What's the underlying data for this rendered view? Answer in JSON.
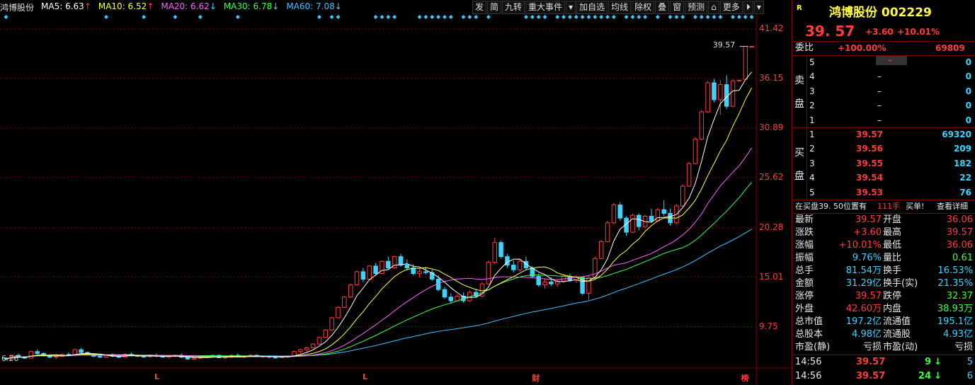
{
  "ma": {
    "stock": "鸿博股份",
    "ma5": {
      "label": "MA5: 6.63",
      "arrow": "↑",
      "color": "#ffffff"
    },
    "ma10": {
      "label": "MA10: 6.52",
      "arrow": "↑",
      "color": "#ffff40"
    },
    "ma20": {
      "label": "MA20: 6.62",
      "arrow": "↓",
      "color": "#ff60ff"
    },
    "ma30": {
      "label": "MA30: 6.78",
      "arrow": "↓",
      "color": "#40ff40"
    },
    "ma60": {
      "label": "MA60: 7.08",
      "arrow": "↓",
      "color": "#40c0ff"
    }
  },
  "toolbar": {
    "fa": "发",
    "jian": "简",
    "jiuzhuan": "九转",
    "events": "重大事件",
    "dropdown": "▾",
    "add": "加自选",
    "avg": "均线",
    "exright": "除权",
    "overlay": "叠",
    "window": "窗",
    "predict": "预测",
    "lock": "⌂",
    "more": "更多",
    "expand": "⏵",
    "dropdown2": "▾"
  },
  "axis": {
    "labels": [
      "41.42",
      "36.15",
      "30.89",
      "25.62",
      "20.28",
      "15.01",
      "9.75"
    ],
    "low_label": "6.26",
    "high_label": "39.57",
    "markers": [
      {
        "text": "L",
        "pos": 0.195
      },
      {
        "text": "L",
        "pos": 0.458
      },
      {
        "text": "财",
        "pos": 0.672
      },
      {
        "text": "榜",
        "pos": 0.936
      }
    ]
  },
  "chart_data": {
    "type": "candlestick",
    "ylim": [
      5.5,
      43.0
    ],
    "y_ticks": [
      41.42,
      36.15,
      30.89,
      25.62,
      20.28,
      15.01,
      9.75
    ],
    "n": 120,
    "candles": [
      [
        6.4,
        6.5,
        6.2,
        6.3
      ],
      [
        6.3,
        6.8,
        6.25,
        6.7
      ],
      [
        6.7,
        6.9,
        6.5,
        6.55
      ],
      [
        6.55,
        6.6,
        6.3,
        6.4
      ],
      [
        6.4,
        7.2,
        6.35,
        7.1
      ],
      [
        7.1,
        7.3,
        6.8,
        6.9
      ],
      [
        6.9,
        7.0,
        6.6,
        6.7
      ],
      [
        6.7,
        6.8,
        6.4,
        6.5
      ],
      [
        6.5,
        6.7,
        6.3,
        6.6
      ],
      [
        6.6,
        6.9,
        6.5,
        6.8
      ],
      [
        6.8,
        7.0,
        6.6,
        6.7
      ],
      [
        6.7,
        7.4,
        6.6,
        7.3
      ],
      [
        7.3,
        7.5,
        6.9,
        7.0
      ],
      [
        7.0,
        7.1,
        6.7,
        6.8
      ],
      [
        6.8,
        6.9,
        6.5,
        6.6
      ],
      [
        6.6,
        6.7,
        6.4,
        6.5
      ],
      [
        6.5,
        6.8,
        6.4,
        6.7
      ],
      [
        6.7,
        6.9,
        6.5,
        6.6
      ],
      [
        6.6,
        6.7,
        6.4,
        6.5
      ],
      [
        6.5,
        6.9,
        6.45,
        6.8
      ],
      [
        6.8,
        7.0,
        6.6,
        6.7
      ],
      [
        6.7,
        6.8,
        6.5,
        6.6
      ],
      [
        6.6,
        6.7,
        6.4,
        6.55
      ],
      [
        6.55,
        6.8,
        6.5,
        6.7
      ],
      [
        6.7,
        6.9,
        6.5,
        6.6
      ],
      [
        6.6,
        6.75,
        6.45,
        6.5
      ],
      [
        6.5,
        6.7,
        6.4,
        6.6
      ],
      [
        6.6,
        6.8,
        6.5,
        6.7
      ],
      [
        6.7,
        6.9,
        6.4,
        6.5
      ],
      [
        6.5,
        6.6,
        6.2,
        6.3
      ],
      [
        6.3,
        6.5,
        6.2,
        6.4
      ],
      [
        6.4,
        6.6,
        6.3,
        6.5
      ],
      [
        6.5,
        6.7,
        6.4,
        6.6
      ],
      [
        6.6,
        6.8,
        6.5,
        6.7
      ],
      [
        6.7,
        6.8,
        6.4,
        6.45
      ],
      [
        6.45,
        6.6,
        6.3,
        6.5
      ],
      [
        6.5,
        6.8,
        6.45,
        6.7
      ],
      [
        6.7,
        6.9,
        6.5,
        6.55
      ],
      [
        6.55,
        6.7,
        6.4,
        6.6
      ],
      [
        6.6,
        6.8,
        6.5,
        6.7
      ],
      [
        6.7,
        6.8,
        6.5,
        6.55
      ],
      [
        6.55,
        6.7,
        6.4,
        6.6
      ],
      [
        6.6,
        6.7,
        6.4,
        6.5
      ],
      [
        6.5,
        6.6,
        6.35,
        6.45
      ],
      [
        6.45,
        6.6,
        6.4,
        6.55
      ],
      [
        6.55,
        6.7,
        6.45,
        6.6
      ],
      [
        6.6,
        7.2,
        6.55,
        7.1
      ],
      [
        7.1,
        7.4,
        6.9,
        7.3
      ],
      [
        7.3,
        7.6,
        7.1,
        7.5
      ],
      [
        7.5,
        8.0,
        7.4,
        7.9
      ],
      [
        7.9,
        8.7,
        7.8,
        8.6
      ],
      [
        8.6,
        9.5,
        8.5,
        9.4
      ],
      [
        9.4,
        10.8,
        9.3,
        10.7
      ],
      [
        10.7,
        11.9,
        10.6,
        11.8
      ],
      [
        11.8,
        13.0,
        11.7,
        12.9
      ],
      [
        12.9,
        14.3,
        12.8,
        14.2
      ],
      [
        14.2,
        15.7,
        14.1,
        15.6
      ],
      [
        15.6,
        16.0,
        14.5,
        14.8
      ],
      [
        14.8,
        16.3,
        14.7,
        16.2
      ],
      [
        16.2,
        16.5,
        15.2,
        15.4
      ],
      [
        15.4,
        16.8,
        15.3,
        16.7
      ],
      [
        16.7,
        17.2,
        15.8,
        16.0
      ],
      [
        16.0,
        17.3,
        15.9,
        17.2
      ],
      [
        17.2,
        17.5,
        16.1,
        16.3
      ],
      [
        16.3,
        16.9,
        15.7,
        16.0
      ],
      [
        16.0,
        16.4,
        15.2,
        15.4
      ],
      [
        15.4,
        15.9,
        15.0,
        15.6
      ],
      [
        15.6,
        16.1,
        15.3,
        15.5
      ],
      [
        15.5,
        15.8,
        14.6,
        14.8
      ],
      [
        14.8,
        15.2,
        13.5,
        13.7
      ],
      [
        13.7,
        14.0,
        12.7,
        12.9
      ],
      [
        12.9,
        13.3,
        12.2,
        12.5
      ],
      [
        12.5,
        13.2,
        12.4,
        13.0
      ],
      [
        13.0,
        13.4,
        12.3,
        12.5
      ],
      [
        12.5,
        13.6,
        12.4,
        13.4
      ],
      [
        13.4,
        13.8,
        12.8,
        13.0
      ],
      [
        13.0,
        14.5,
        12.9,
        14.3
      ],
      [
        14.3,
        16.8,
        14.2,
        16.6
      ],
      [
        16.6,
        19.2,
        16.4,
        18.7
      ],
      [
        18.7,
        18.9,
        17.0,
        17.2
      ],
      [
        17.2,
        17.5,
        16.0,
        16.3
      ],
      [
        16.3,
        16.8,
        15.5,
        15.8
      ],
      [
        15.8,
        16.9,
        15.6,
        16.7
      ],
      [
        16.7,
        17.2,
        15.8,
        16.0
      ],
      [
        16.0,
        16.2,
        14.9,
        15.1
      ],
      [
        15.1,
        15.4,
        14.0,
        14.2
      ],
      [
        14.2,
        14.8,
        13.8,
        14.5
      ],
      [
        14.5,
        15.0,
        14.1,
        14.3
      ],
      [
        14.3,
        14.8,
        14.0,
        14.6
      ],
      [
        14.6,
        15.3,
        14.4,
        15.1
      ],
      [
        15.1,
        15.4,
        14.5,
        14.7
      ],
      [
        14.7,
        15.2,
        14.4,
        15.0
      ],
      [
        15.0,
        15.1,
        13.1,
        13.3
      ],
      [
        13.3,
        15.2,
        12.6,
        15.0
      ],
      [
        15.0,
        17.2,
        14.9,
        17.0
      ],
      [
        17.0,
        19.0,
        16.9,
        18.8
      ],
      [
        18.8,
        21.0,
        18.7,
        20.8
      ],
      [
        20.8,
        22.9,
        20.6,
        22.7
      ],
      [
        22.7,
        23.0,
        21.0,
        21.3
      ],
      [
        21.3,
        21.5,
        19.4,
        19.8
      ],
      [
        19.8,
        21.8,
        19.7,
        21.6
      ],
      [
        21.6,
        21.8,
        20.0,
        20.4
      ],
      [
        20.4,
        21.7,
        20.2,
        21.5
      ],
      [
        21.5,
        22.3,
        20.8,
        21.0
      ],
      [
        21.0,
        22.4,
        20.9,
        22.2
      ],
      [
        22.2,
        23.2,
        21.5,
        21.8
      ],
      [
        21.8,
        22.3,
        20.5,
        20.8
      ],
      [
        20.8,
        22.8,
        20.6,
        22.6
      ],
      [
        22.6,
        24.9,
        22.5,
        24.7
      ],
      [
        24.7,
        27.3,
        24.6,
        27.1
      ],
      [
        27.1,
        29.9,
        27.0,
        29.7
      ],
      [
        29.7,
        32.8,
        29.6,
        32.6
      ],
      [
        32.6,
        35.9,
        32.5,
        35.7
      ],
      [
        35.7,
        36.1,
        33.6,
        33.9
      ],
      [
        33.9,
        36.0,
        32.3,
        35.5
      ],
      [
        35.5,
        36.5,
        32.9,
        33.2
      ],
      [
        33.2,
        36.1,
        33.1,
        35.9
      ],
      [
        35.9,
        36.0,
        35.8,
        35.97
      ],
      [
        36.06,
        39.57,
        36.06,
        39.57
      ],
      [
        39.57,
        39.57,
        39.57,
        39.57
      ]
    ]
  },
  "panel": {
    "r_tag": "R",
    "title": "鸿博股份 002229",
    "price": "39. 57",
    "change": "+3.60",
    "pct": "+10.01%",
    "weibi_label": "委比",
    "weibi_pct": "+100.00%",
    "weibi_val": "69809",
    "sell_label1": "卖",
    "sell_label2": "盘",
    "buy_label1": "买",
    "buy_label2": "盘",
    "sells": [
      {
        "lv": "5",
        "price": "",
        "vol": "0"
      },
      {
        "lv": "4",
        "price": "–",
        "vol": "0"
      },
      {
        "lv": "3",
        "price": "–",
        "vol": "0"
      },
      {
        "lv": "2",
        "price": "–",
        "vol": "0"
      },
      {
        "lv": "1",
        "price": "–",
        "vol": "0"
      }
    ],
    "buys": [
      {
        "lv": "1",
        "price": "39.57",
        "vol": "69320"
      },
      {
        "lv": "2",
        "price": "39.56",
        "vol": "209"
      },
      {
        "lv": "3",
        "price": "39.55",
        "vol": "182"
      },
      {
        "lv": "4",
        "price": "39.54",
        "vol": "22"
      },
      {
        "lv": "5",
        "price": "39.53",
        "vol": "76"
      }
    ],
    "notice_pre": "在买盘39. 50位置有",
    "notice_num": "111手",
    "notice_post": "买单!",
    "notice_link": "查看详细",
    "stats": [
      {
        "k1": "最新",
        "v1": "39.57",
        "c1": "red",
        "k2": "开盘",
        "v2": "36.06",
        "c2": "red"
      },
      {
        "k1": "涨跌",
        "v1": "+3.60",
        "c1": "red",
        "k2": "最高",
        "v2": "39.57",
        "c2": "red"
      },
      {
        "k1": "涨幅",
        "v1": "+10.01%",
        "c1": "red",
        "k2": "最低",
        "v2": "36.06",
        "c2": "red"
      },
      {
        "k1": "振幅",
        "v1": "9.76%",
        "c1": "cyan",
        "k2": "量比",
        "v2": "0.61",
        "c2": "green"
      },
      {
        "k1": "总手",
        "v1": "81.54万",
        "c1": "cyan",
        "k2": "换手",
        "v2": "16.53%",
        "c2": "cyan"
      },
      {
        "k1": "金额",
        "v1": "31.29亿",
        "c1": "cyan",
        "k2": "换手(实)",
        "v2": "21.35%",
        "c2": "cyan"
      },
      {
        "k1": "涨停",
        "v1": "39.57",
        "c1": "red",
        "k2": "跌停",
        "v2": "32.37",
        "c2": "green"
      },
      {
        "k1": "外盘",
        "v1": "42.60万",
        "c1": "red",
        "k2": "内盘",
        "v2": "38.93万",
        "c2": "green"
      },
      {
        "k1": "总市值",
        "v1": "197.2亿",
        "c1": "cyan",
        "k2": "流通值",
        "v2": "195.1亿",
        "c2": "cyan"
      },
      {
        "k1": "总股本",
        "v1": "4.98亿",
        "c1": "cyan",
        "k2": "流通股",
        "v2": "4.93亿",
        "c2": "cyan"
      },
      {
        "k1": "市盈(静)",
        "v1": "亏损",
        "c1": "white",
        "k2": "市盈(动)",
        "v2": "亏损",
        "c2": "white"
      }
    ],
    "ticks": [
      {
        "time": "14:56",
        "price": "39.57",
        "vol": "9",
        "arrow": "↓",
        "n": "5"
      },
      {
        "time": "14:56",
        "price": "39.57",
        "vol": "24",
        "arrow": "↓",
        "n": "6"
      }
    ]
  }
}
